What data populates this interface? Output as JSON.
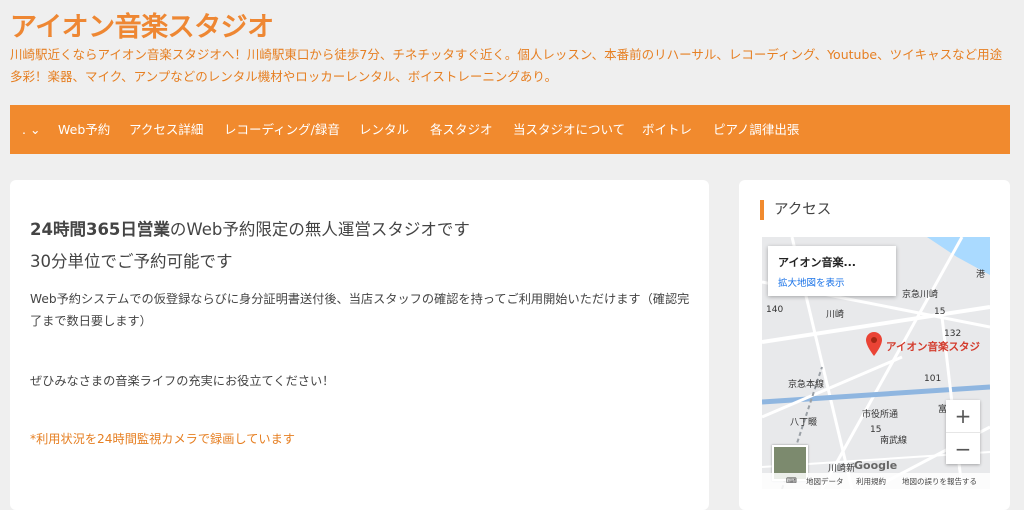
{
  "site": {
    "title": "アイオン音楽スタジオ",
    "description": "川崎駅近くならアイオン音楽スタジオへ！川崎駅東口から徒歩7分、チネチッタすぐ近く。個人レッスン、本番前のリハーサル、レコーディング、Youtube、ツイキャスなど用途多彩！楽器、マイク、アンプなどのレンタル機材やロッカーレンタル、ボイストレーニングあり。"
  },
  "nav": {
    "toggle": ". ⌄",
    "items": [
      "Web予約",
      "アクセス詳細",
      "レコーディング/録音",
      "レンタル",
      "各スタジオ",
      "当スタジオについて",
      "ボイトレ",
      "ピアノ調律出張"
    ]
  },
  "main": {
    "lead_bold": "24時間365日営業",
    "lead_rest": "のWeb予約限定の無人運営スタジオです",
    "lead2": "30分単位でご予約可能です",
    "para1": "Web予約システムでの仮登録ならびに身分証明書送付後、当店スタッフの確認を持ってご利用開始いただけます（確認完了まで数日要します）",
    "para2": "ぜひみなさまの音楽ライフの充実にお役立てください！",
    "para3": "*利用状況を24時間監視カメラで録画しています"
  },
  "sidebar": {
    "title": "アクセス",
    "map": {
      "popup_title": "アイオン音楽...",
      "popup_link": "拡大地図を表示",
      "place_label": "アイオン音楽スタジ",
      "labels": {
        "keikyu": "京急川崎",
        "kawasaki": "川崎",
        "hacchonawate": "八丁畷",
        "kawasakishin": "川崎新",
        "route140": "140",
        "route15a": "15",
        "route15b": "15",
        "route132": "132",
        "route101": "101",
        "nanbu": "南武線",
        "keikyu_line": "京急本線",
        "shiyakusho": "市役所通",
        "fujimi": "富士見",
        "minato": "港"
      },
      "zoom_in": "+",
      "zoom_out": "−",
      "google": "Google",
      "footer": {
        "keyboard": "⌨",
        "map_data": "地図データ",
        "terms": "利用規約",
        "report": "地図の誤りを報告する"
      }
    }
  },
  "colors": {
    "accent": "#f18a2e",
    "title": "#ee8733",
    "text": "#444444",
    "link": "#1a73e8",
    "marker": "#d33b2c"
  }
}
